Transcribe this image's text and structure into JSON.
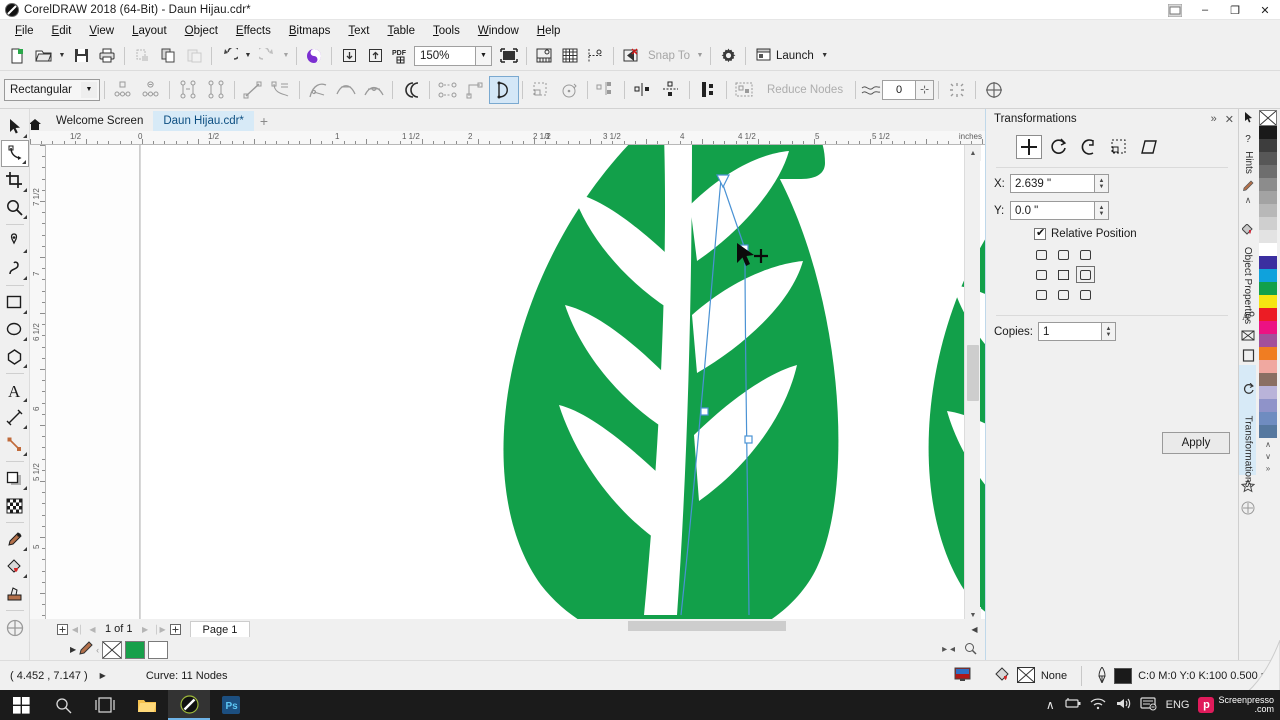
{
  "titlebar": {
    "title": "CorelDRAW 2018 (64-Bit) - Daun Hijau.cdr*",
    "restore_icon": "restore-window-icon",
    "minimize": "–",
    "maximize": "❐",
    "close": "✕"
  },
  "menubar": {
    "items": [
      {
        "label": "File"
      },
      {
        "label": "Edit"
      },
      {
        "label": "View"
      },
      {
        "label": "Layout"
      },
      {
        "label": "Object"
      },
      {
        "label": "Effects"
      },
      {
        "label": "Bitmaps"
      },
      {
        "label": "Text"
      },
      {
        "label": "Table"
      },
      {
        "label": "Tools"
      },
      {
        "label": "Window"
      },
      {
        "label": "Help"
      }
    ]
  },
  "toolbar": {
    "zoom_level": "150%",
    "snap_to_label": "Snap To",
    "launch_label": "Launch",
    "buttons": [
      {
        "name": "new-document-icon"
      },
      {
        "name": "open-document-icon"
      },
      {
        "name": "save-document-icon"
      },
      {
        "name": "print-icon"
      },
      {
        "name": "cut-icon"
      },
      {
        "name": "copy-icon"
      },
      {
        "name": "paste-icon"
      },
      {
        "name": "undo-icon"
      },
      {
        "name": "redo-icon"
      },
      {
        "name": "corel-connect-icon"
      },
      {
        "name": "import-icon"
      },
      {
        "name": "export-icon"
      },
      {
        "name": "publish-pdf-icon"
      },
      {
        "name": "full-screen-preview-icon"
      },
      {
        "name": "show-rulers-icon"
      },
      {
        "name": "show-grid-icon"
      },
      {
        "name": "show-guidelines-icon"
      },
      {
        "name": "snap-off-icon"
      },
      {
        "name": "options-gear-icon"
      }
    ]
  },
  "propertybar": {
    "shape_mode": "Rectangular",
    "reduce_nodes_label": "Reduce Nodes",
    "curve_smoothness": "0",
    "buttons": [
      {
        "name": "add-node-icon"
      },
      {
        "name": "delete-node-icon"
      },
      {
        "name": "join-two-nodes-icon"
      },
      {
        "name": "break-curve-icon"
      },
      {
        "name": "convert-to-line-icon"
      },
      {
        "name": "convert-to-curve-icon"
      },
      {
        "name": "cusp-node-icon"
      },
      {
        "name": "smooth-node-icon"
      },
      {
        "name": "symmetrical-node-icon"
      },
      {
        "name": "reverse-direction-icon"
      },
      {
        "name": "extend-curve-to-close-icon"
      },
      {
        "name": "extract-subpath-icon"
      },
      {
        "name": "close-curve-icon"
      },
      {
        "name": "stretch-nodes-icon"
      },
      {
        "name": "rotate-nodes-icon"
      },
      {
        "name": "align-nodes-icon"
      },
      {
        "name": "reflect-nodes-horizontal-icon"
      },
      {
        "name": "reflect-nodes-vertical-icon"
      },
      {
        "name": "elastic-mode-icon"
      },
      {
        "name": "select-all-nodes-icon"
      },
      {
        "name": "curve-smoothness-icon"
      },
      {
        "name": "marquee-select-icon"
      },
      {
        "name": "add-target-icon"
      }
    ]
  },
  "document_tabs": {
    "home_icon": "home-icon",
    "tabs": [
      {
        "label": "Welcome Screen",
        "active": false
      },
      {
        "label": "Daun Hijau.cdr*",
        "active": true
      }
    ],
    "new_tab": "+"
  },
  "toolbox": {
    "tools": [
      {
        "name": "pick-tool",
        "active": false
      },
      {
        "name": "shape-tool",
        "active": true
      },
      {
        "name": "crop-tool",
        "active": false
      },
      {
        "name": "zoom-tool",
        "active": false
      },
      {
        "name": "freehand-tool",
        "active": false
      },
      {
        "name": "artistic-media-tool",
        "active": false
      },
      {
        "name": "rectangle-tool",
        "active": false
      },
      {
        "name": "ellipse-tool",
        "active": false
      },
      {
        "name": "polygon-tool",
        "active": false
      },
      {
        "name": "text-tool",
        "active": false
      },
      {
        "name": "parallel-dimension-tool",
        "active": false
      },
      {
        "name": "straight-line-connector-tool",
        "active": false
      },
      {
        "name": "drop-shadow-tool",
        "active": false
      },
      {
        "name": "transparency-tool",
        "active": false
      },
      {
        "name": "color-eyedropper-tool",
        "active": false
      },
      {
        "name": "interactive-fill-tool",
        "active": false
      },
      {
        "name": "smart-fill-tool",
        "active": false
      },
      {
        "name": "quick-customize-tool",
        "active": false
      }
    ]
  },
  "rulers": {
    "unit_label": "inches",
    "horizontal_labels": [
      "1/2",
      "0",
      "1/2",
      "1",
      "1 1/2",
      "2",
      "2 1/2",
      "3",
      "3 1/2",
      "4",
      "4 1/2",
      "5",
      "5 1/2"
    ],
    "vertical_labels": [
      "7 1/2",
      "7",
      "6 1/2",
      "6",
      "5 1/2",
      "5"
    ]
  },
  "page_navigator": {
    "page_count_label": "1 of 1",
    "page_tab": "Page 1",
    "add_page_icon": "add-page-icon",
    "first_icon": "◀│",
    "prev_icon": "◀",
    "next_icon": "▶",
    "last_icon": "│▶"
  },
  "color_strip": {
    "no_color": "no-color-swatch",
    "fill_color": "#17a04a",
    "outline_color": "#ffffff"
  },
  "statusbar": {
    "coordinates": "( 4.452 , 7.147 )",
    "selection_info": "Curve: 11 Nodes",
    "fill_label": "None",
    "outline_swatch": "#1a1a1a",
    "outline_label": "C:0 M:0 Y:0 K:100  0.500 pt",
    "document_color_icon": "color-proof-icon"
  },
  "docker": {
    "title": "Transformations",
    "collapse_icon": "»",
    "close_icon": "✕",
    "modes": [
      {
        "name": "position-mode",
        "selected": true
      },
      {
        "name": "rotate-mode",
        "selected": false
      },
      {
        "name": "scale-mirror-mode",
        "selected": false
      },
      {
        "name": "size-mode",
        "selected": false
      },
      {
        "name": "skew-mode",
        "selected": false
      }
    ],
    "x_label": "X:",
    "x_value": "2.639 \"",
    "y_label": "Y:",
    "y_value": "0.0 \"",
    "relative_position_label": "Relative Position",
    "relative_position_checked": true,
    "anchor_selected_index": 5,
    "copies_label": "Copies:",
    "copies_value": "1",
    "apply_label": "Apply"
  },
  "rail": {
    "tabs": [
      {
        "label": "Hints",
        "selected": false,
        "icon": "hints-icon"
      },
      {
        "label": "Object Properties",
        "selected": false,
        "icon": "object-properties-icon"
      },
      {
        "label": "Transformations",
        "selected": true,
        "icon": "transformations-icon"
      }
    ],
    "extra_icons": [
      "pick-arrow-icon",
      "pen-icon",
      "chevron-up-icon",
      "no-color-icon",
      "text-properties-icon",
      "frame-icon",
      "page-icon",
      "favorites-star-icon",
      "add-docker-icon"
    ]
  },
  "palette": {
    "no_color_name": "no-color-swatch",
    "colors": [
      "#1a1a1a",
      "#3d3d3d",
      "#575757",
      "#6e6e6e",
      "#8c8c8c",
      "#a3a3a3",
      "#b8b8b8",
      "#cfcfcf",
      "#e3e3e3",
      "#ffffff",
      "#3b2fa0",
      "#0fa2dc",
      "#12a04a",
      "#f5e512",
      "#ec1c24",
      "#ec1283",
      "#a3509b",
      "#f07d22",
      "#f0a8a0",
      "#8a6f63",
      "#b9b3d9",
      "#8f93c9",
      "#6f8cc0",
      "#56789f"
    ],
    "scroll_up": "∧",
    "scroll_down": "∨",
    "expand": "»"
  },
  "taskbar": {
    "start_icon": "windows-start-icon",
    "search_icon": "search-icon",
    "taskview_icon": "task-view-icon",
    "apps": [
      {
        "name": "file-explorer-icon"
      },
      {
        "name": "coreldraw-icon",
        "running": true
      },
      {
        "name": "photoshop-icon",
        "label": "Ps"
      }
    ],
    "tray": {
      "chevron": "∧",
      "icons": [
        "battery-icon",
        "wifi-icon",
        "volume-icon",
        "action-center-icon"
      ],
      "language": "ENG",
      "watermark_title": "Screenpresso",
      "watermark_sub": ".com"
    }
  },
  "artwork": {
    "leaf_color": "#12a04a",
    "selection_color": "#4a92d4",
    "node_count": 11
  }
}
